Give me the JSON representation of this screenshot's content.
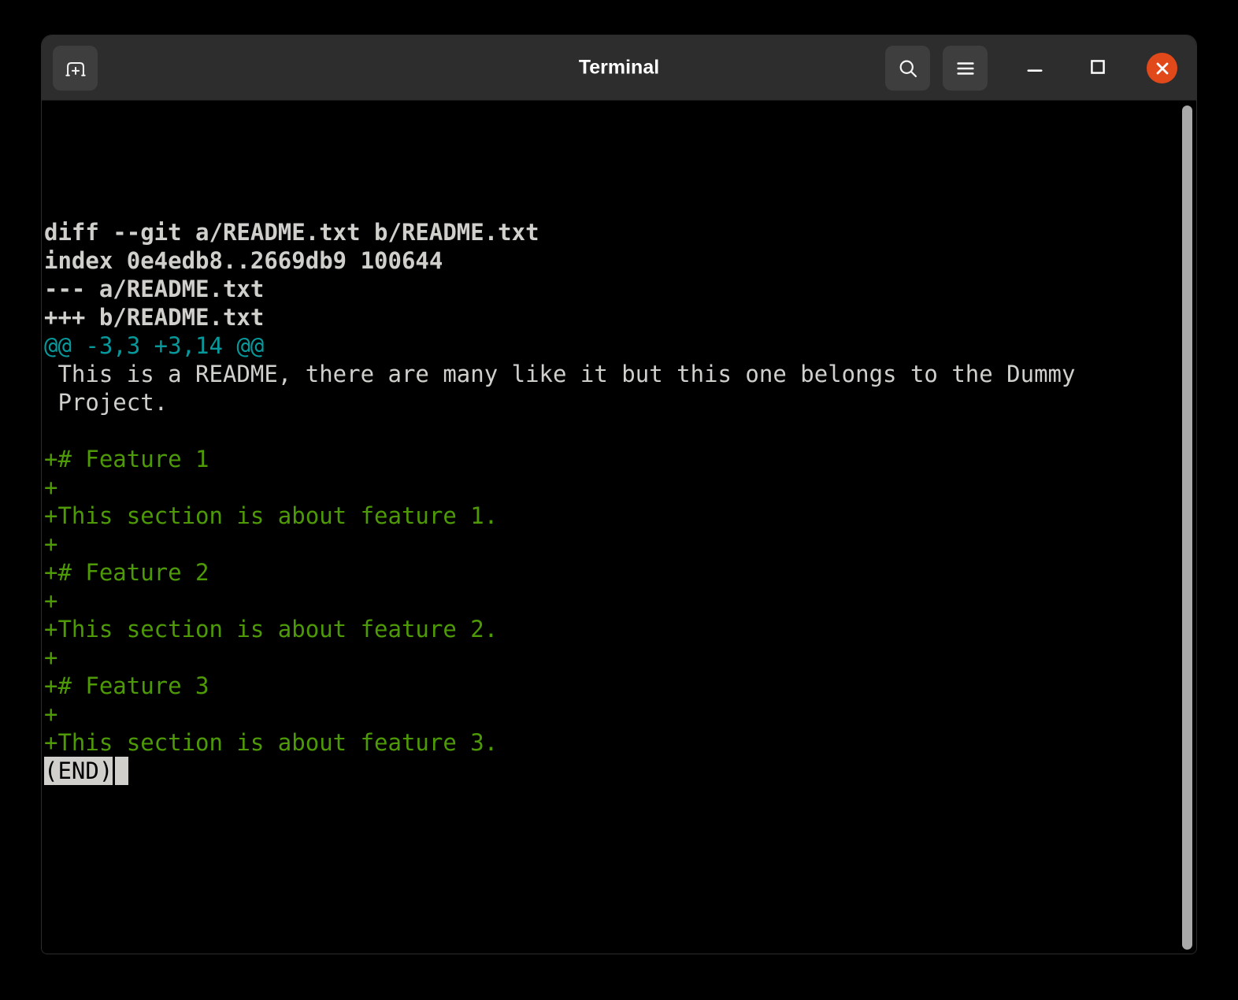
{
  "window": {
    "title": "Terminal",
    "titlebar": {
      "icons": [
        "new-tab-icon",
        "search-icon",
        "menu-icon",
        "minimize-icon",
        "maximize-icon",
        "close-icon"
      ]
    }
  },
  "terminal": {
    "lines": [
      {
        "t": "diff --git a/README.txt b/README.txt",
        "c": "header"
      },
      {
        "t": "index 0e4edb8..2669db9 100644",
        "c": "header"
      },
      {
        "t": "--- a/README.txt",
        "c": "header"
      },
      {
        "t": "+++ b/README.txt",
        "c": "header"
      },
      {
        "t": "@@ -3,3 +3,14 @@",
        "c": "hunk"
      },
      {
        "t": " This is a README, there are many like it but this one belongs to the Dummy",
        "c": "ctx"
      },
      {
        "t": " Project.",
        "c": "ctx"
      },
      {
        "t": "",
        "c": "blank"
      },
      {
        "t": "+# Feature 1",
        "c": "add"
      },
      {
        "t": "+",
        "c": "add"
      },
      {
        "t": "+This section is about feature 1.",
        "c": "add"
      },
      {
        "t": "+",
        "c": "add"
      },
      {
        "t": "+# Feature 2",
        "c": "add"
      },
      {
        "t": "+",
        "c": "add"
      },
      {
        "t": "+This section is about feature 2.",
        "c": "add"
      },
      {
        "t": "+",
        "c": "add"
      },
      {
        "t": "+# Feature 3",
        "c": "add"
      },
      {
        "t": "+",
        "c": "add"
      },
      {
        "t": "+This section is about feature 3.",
        "c": "add"
      },
      {
        "t": "(END)",
        "c": "end"
      }
    ],
    "pager_end_label": "(END)"
  },
  "colors": {
    "header-bg": "#2d2d2d",
    "btn-bg": "#3e3e3e",
    "close-bg": "#e2491a",
    "fg": "#d0cfcc",
    "green": "#4e9a06",
    "cyan": "#06989a",
    "thumb": "#a9a9a9"
  }
}
